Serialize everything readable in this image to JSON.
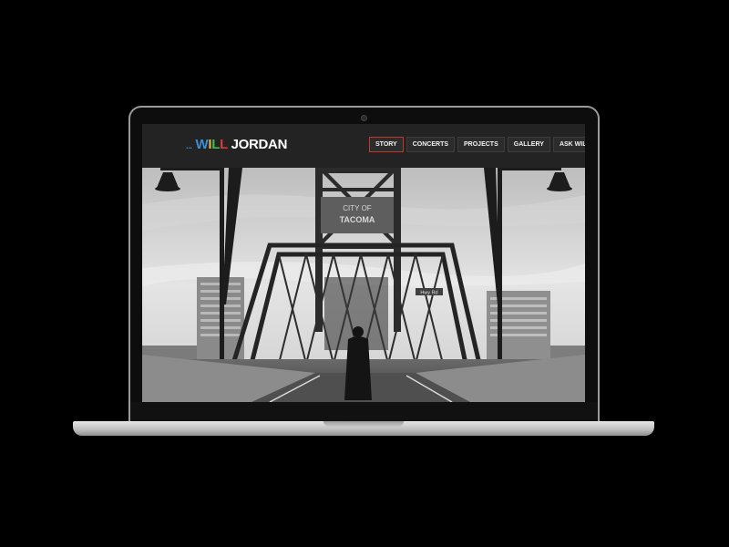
{
  "site": {
    "logo_dots": "...",
    "logo_letters": [
      "W",
      "I",
      "L",
      "L"
    ],
    "logo_last": "JORDAN"
  },
  "nav": {
    "items": [
      {
        "label": "STORY",
        "active": true
      },
      {
        "label": "CONCERTS",
        "active": false
      },
      {
        "label": "PROJECTS",
        "active": false
      },
      {
        "label": "GALLERY",
        "active": false
      },
      {
        "label": "ASK WILL",
        "active": false
      }
    ]
  },
  "hero": {
    "sign_line1": "CITY OF",
    "sign_line2": "TACOMA",
    "street_sign": "Hwy Rd"
  },
  "colors": {
    "page_bg": "#000000",
    "header_bg": "#232323",
    "active_nav_border": "#c0392b",
    "logo_w": "#3a8fd6",
    "logo_i": "#e0b43a",
    "logo_l1": "#43b84c",
    "logo_l2": "#d93a3a"
  }
}
